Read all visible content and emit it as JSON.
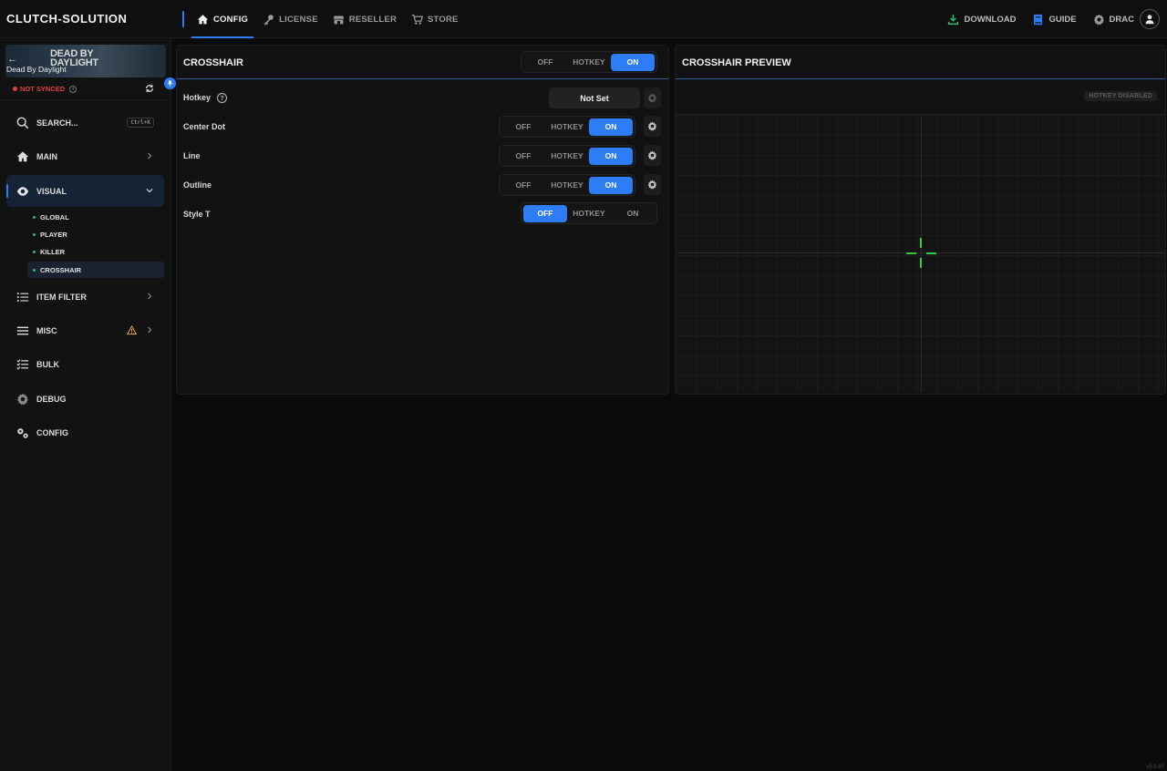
{
  "app": {
    "brand": "CLUTCH-SOLUTION",
    "version": "v5.0.87"
  },
  "nav": {
    "tabs": [
      {
        "label": "CONFIG",
        "icon": "home-icon",
        "active": true
      },
      {
        "label": "LICENSE",
        "icon": "key-icon"
      },
      {
        "label": "RESELLER",
        "icon": "store-icon"
      },
      {
        "label": "STORE",
        "icon": "cart-icon"
      }
    ],
    "download_label": "DOWNLOAD",
    "guide_label": "GUIDE",
    "user_label": "DRAC"
  },
  "colors": {
    "accent": "#2f7df6",
    "download": "#2fbf71",
    "crosshair": "#2ecc40",
    "error": "#e04040",
    "warning": "#e8a33a"
  },
  "sidebar": {
    "game": {
      "logo_text": "DEAD BY DAYLIGHT",
      "name": "Dead By Daylight"
    },
    "sync_status": "NOT SYNCED",
    "search_label": "SEARCH...",
    "search_shortcut": "Ctrl+K",
    "items": [
      {
        "label": "MAIN",
        "icon": "home-icon"
      },
      {
        "label": "VISUAL",
        "icon": "eye-icon",
        "expanded": true
      },
      {
        "label": "ITEM FILTER",
        "icon": "list-icon"
      },
      {
        "label": "MISC",
        "icon": "menu-icon",
        "warning": true
      },
      {
        "label": "BULK",
        "icon": "checklist-icon"
      },
      {
        "label": "DEBUG",
        "icon": "gear-icon"
      },
      {
        "label": "CONFIG",
        "icon": "gears-icon"
      }
    ],
    "visual_sub": [
      {
        "label": "GLOBAL"
      },
      {
        "label": "PLAYER"
      },
      {
        "label": "KILLER"
      },
      {
        "label": "CROSSHAIR",
        "active": true
      }
    ]
  },
  "crosshair": {
    "title": "CROSSHAIR",
    "toggle": {
      "off": "OFF",
      "hotkey": "HOTKEY",
      "on": "ON",
      "selected": "ON"
    },
    "rows": [
      {
        "label": "Hotkey",
        "value": "Not Set"
      },
      {
        "label": "Center Dot",
        "off": "OFF",
        "hotkey": "HOTKEY",
        "on": "ON",
        "selected": "ON"
      },
      {
        "label": "Line",
        "off": "OFF",
        "hotkey": "HOTKEY",
        "on": "ON",
        "selected": "ON"
      },
      {
        "label": "Outline",
        "off": "OFF",
        "hotkey": "HOTKEY",
        "on": "ON",
        "selected": "ON"
      },
      {
        "label": "Style T",
        "off": "OFF",
        "hotkey": "HOTKEY",
        "on": "ON",
        "selected": "OFF"
      }
    ]
  },
  "preview": {
    "title": "CROSSHAIR PREVIEW",
    "badge": "HOTKEY DISABLED"
  }
}
